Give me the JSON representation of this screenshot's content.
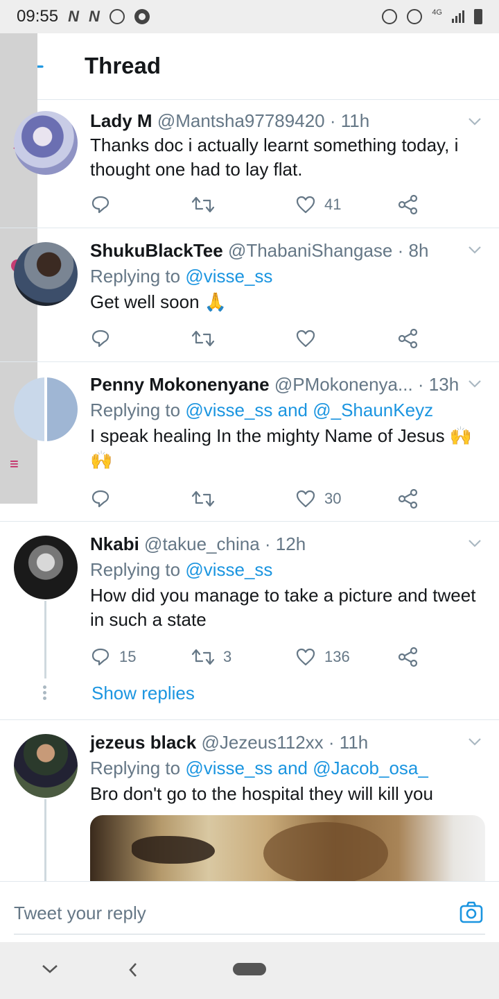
{
  "status_bar": {
    "time": "09:55",
    "left_icons": [
      "N",
      "N",
      "alarm-icon",
      "chrome-icon"
    ],
    "network": "4G",
    "right_icons": [
      "alarm-icon",
      "data-saver-icon",
      "signal-icon",
      "battery-icon"
    ]
  },
  "header": {
    "title": "Thread",
    "back_icon": "arrow-left-icon"
  },
  "tweets": [
    {
      "name": "Lady M",
      "handle": "@Mantsha97789420",
      "time": "· 11h",
      "replying_prefix": "",
      "replying_to": "",
      "text": "Thanks doc i actually learnt something today, i thought one had to lay flat.",
      "replies": "",
      "retweets": "",
      "likes": "41"
    },
    {
      "name": "ShukuBlackTee",
      "handle": "@ThabaniShangase",
      "time": "· 8h",
      "replying_prefix": "Replying to ",
      "replying_to": "@visse_ss",
      "text": "Get well soon 🙏",
      "replies": "",
      "retweets": "",
      "likes": ""
    },
    {
      "name": "Penny Mokonenyane",
      "handle": "@PMokonenya...",
      "time": "· 13h",
      "replying_prefix": "Replying to ",
      "replying_to": "@visse_ss and @_ShaunKeyz",
      "text": "I speak healing In the mighty Name of Jesus 🙌🙌",
      "replies": "",
      "retweets": "",
      "likes": "30"
    },
    {
      "name": "Nkabi",
      "handle": "@takue_china",
      "time": "· 12h",
      "replying_prefix": "Replying to ",
      "replying_to": "@visse_ss",
      "text": "How did you manage to take a picture and tweet in such a state",
      "replies": "15",
      "retweets": "3",
      "likes": "136",
      "show_replies": "Show replies"
    },
    {
      "name": "jezeus black",
      "handle": "@Jezeus112xx",
      "time": "· 11h",
      "replying_prefix": "Replying to ",
      "replying_to": "@visse_ss and @Jacob_osa_",
      "text": "Bro don't go to the hospital they will kill you"
    }
  ],
  "reply_box": {
    "placeholder": "Tweet your reply",
    "camera_icon": "camera-icon"
  },
  "colors": {
    "accent": "#1b95e0",
    "text": "#14171a",
    "muted": "#657786",
    "divider": "#e1e8ed"
  }
}
